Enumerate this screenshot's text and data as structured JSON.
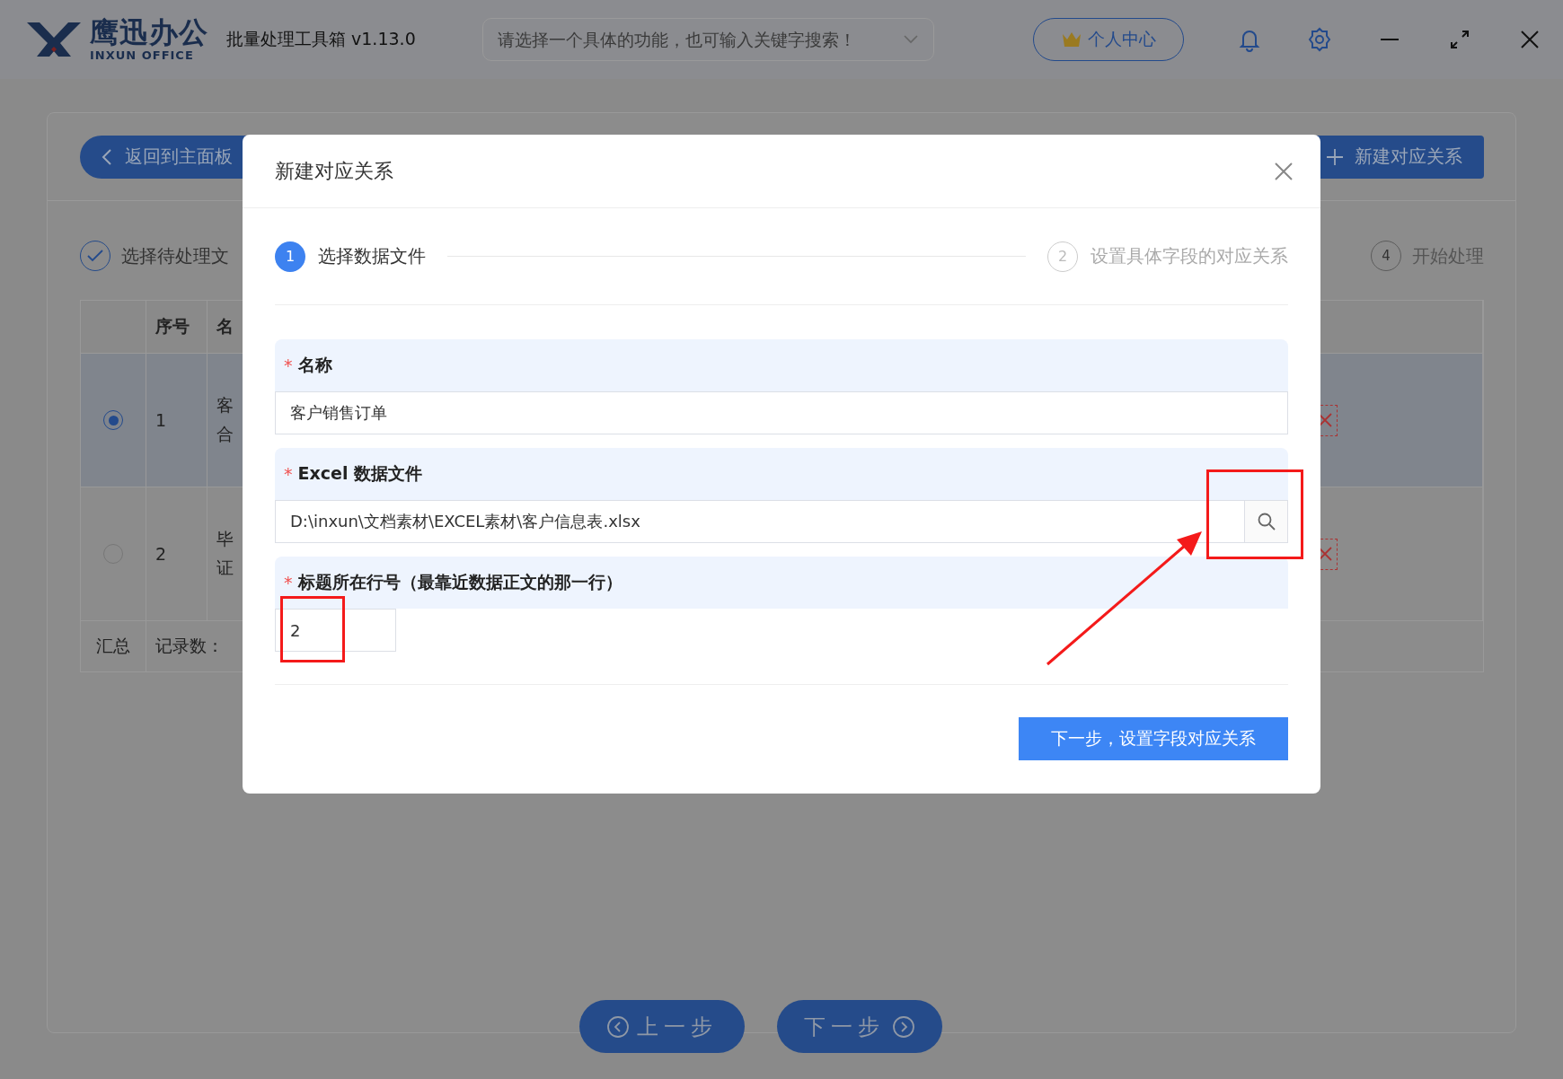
{
  "app_header": {
    "logo_text": "鹰迅办公",
    "logo_subtext": "INXUN OFFICE",
    "app_name": "批量处理工具箱 v1.13.0",
    "search": {
      "placeholder": "请选择一个具体的功能，也可输入关键字搜索！"
    },
    "user_center_button": "个人中心"
  },
  "page": {
    "back_button": "返回到主面板",
    "new_button": "新建对应关系",
    "steps": [
      {
        "label": "选择待处理文",
        "done": true
      },
      {
        "number": "4",
        "label": "开始处理",
        "done": false
      }
    ],
    "table": {
      "columns": [
        "序号",
        "名"
      ],
      "rows": [
        {
          "selected": true,
          "index": "1",
          "name_lines": [
            "客",
            "合"
          ]
        },
        {
          "selected": false,
          "index": "2",
          "name_lines": [
            "毕",
            "证"
          ]
        }
      ],
      "footer": [
        "汇总",
        "记录数："
      ]
    },
    "nav_buttons": [
      {
        "label": "上一步",
        "kind": "prev"
      },
      {
        "label": "下一步",
        "kind": "next"
      }
    ]
  },
  "dialog": {
    "title": "新建对应关系",
    "steps": [
      {
        "number": "1",
        "label": "选择数据文件",
        "selected": true
      },
      {
        "number": "2",
        "label": "设置具体字段的对应关系",
        "selected": false
      }
    ],
    "fields": [
      {
        "required_mark": "*",
        "label": "名称",
        "value": "客户销售订单",
        "kind": "text"
      },
      {
        "required_mark": "*",
        "label": "Excel 数据文件",
        "value": "D:\\inxun\\文档素材\\EXCEL素材\\客户信息表.xlsx",
        "kind": "file"
      },
      {
        "required_mark": "*",
        "label": "标题所在行号（最靠近数据正文的那一行）",
        "value": "2",
        "kind": "number"
      }
    ],
    "submit_button": "下一步，设置字段对应关系"
  }
}
